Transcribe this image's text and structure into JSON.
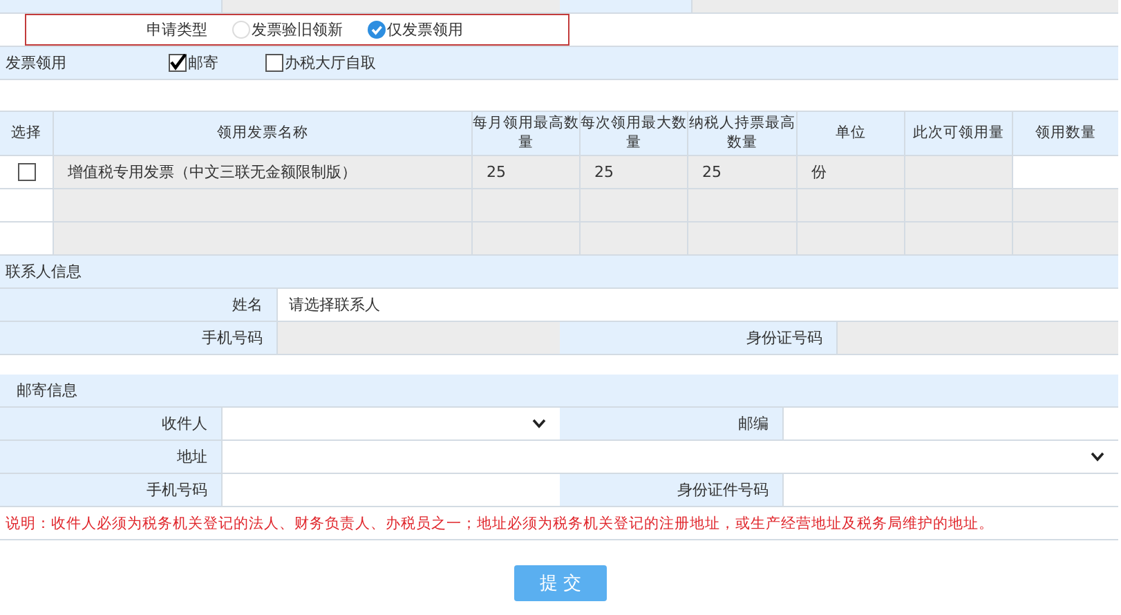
{
  "apply_type": {
    "label": "申请类型",
    "options": [
      {
        "label": "发票验旧领新",
        "selected": false
      },
      {
        "label": "仅发票领用",
        "selected": true
      }
    ]
  },
  "invoice_pickup": {
    "label": "发票领用",
    "options": [
      {
        "label": "邮寄",
        "checked": true
      },
      {
        "label": "办税大厅自取",
        "checked": false
      }
    ]
  },
  "table": {
    "columns": [
      "选择",
      "领用发票名称",
      "每月领用最高数量",
      "每次领用最大数量",
      "纳税人持票最高数量",
      "单位",
      "此次可领用量",
      "领用数量"
    ],
    "rows": [
      {
        "checked": false,
        "cells": [
          "",
          "增值税专用发票（中文三联无金额限制版）",
          "25",
          "25",
          "25",
          "份"
        ]
      }
    ]
  },
  "contact": {
    "title": "联系人信息",
    "name": {
      "label": "姓名",
      "value": "请选择联系人"
    },
    "fields": [
      {
        "label": "手机号码",
        "disabled": true
      },
      {
        "label": "身份证号码",
        "disabled": true
      }
    ]
  },
  "mail": {
    "title": "邮寄信息",
    "recipient": {
      "label": "收件人"
    },
    "postcode": {
      "label": "邮编"
    },
    "address": {
      "label": "地址"
    },
    "phone": {
      "label": "手机号码"
    },
    "id_number": {
      "label": "身份证件号码"
    }
  },
  "note": "说明：收件人必须为税务机关登记的法人、财务负责人、办税员之一；地址必须为税务机关登记的注册地址，或生产经营地址及税务局维护的地址。",
  "submit": "提 交"
}
